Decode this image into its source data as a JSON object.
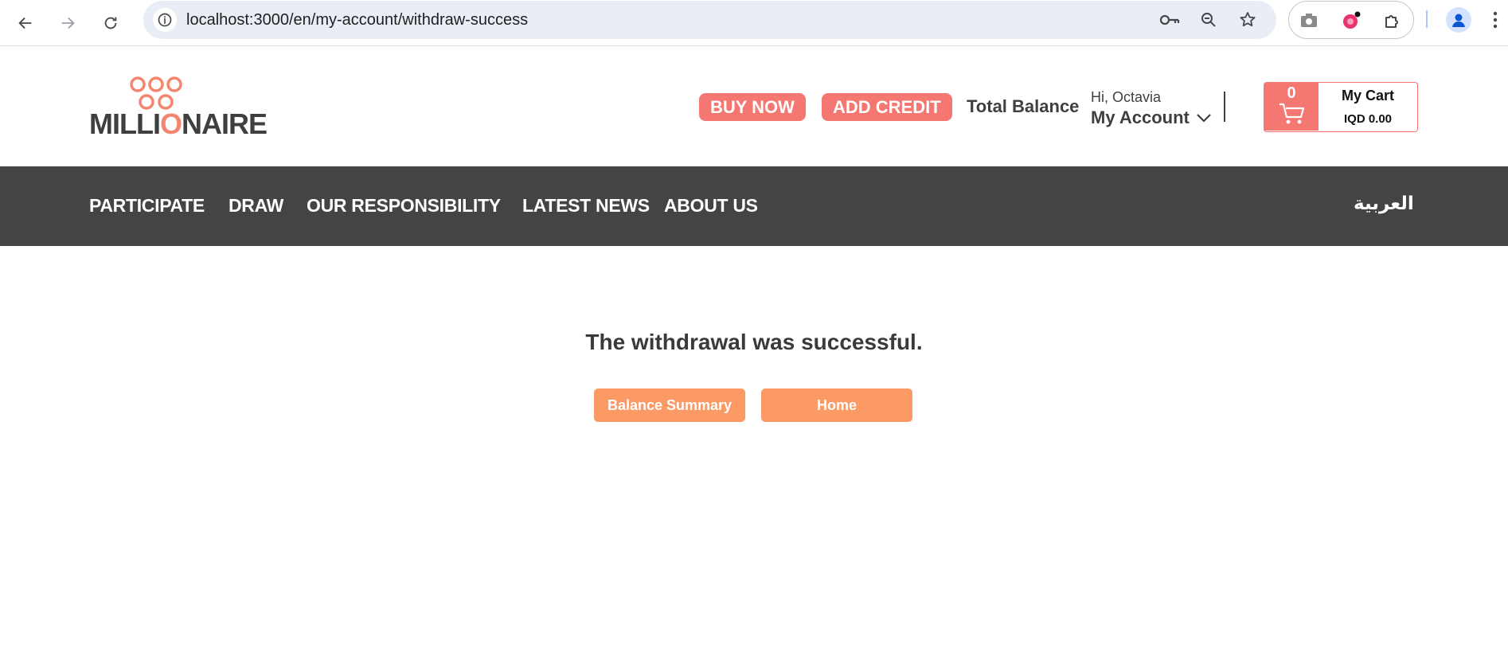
{
  "browser": {
    "url": "localhost:3000/en/my-account/withdraw-success",
    "icons": [
      "back-icon",
      "forward-icon",
      "reload-icon",
      "site-info-icon",
      "password-key-icon",
      "zoom-icon",
      "bookmark-star-icon",
      "camera-icon",
      "extension-record-icon",
      "extensions-puzzle-icon",
      "profile-icon",
      "menu-kebab-icon"
    ]
  },
  "header": {
    "logo_text_pre": "MILLI",
    "logo_text_o": "O",
    "logo_text_post": "NAIRE",
    "buy_now_label": "BUY NOW",
    "add_credit_label": "ADD CREDIT",
    "total_balance_label": "Total Balance",
    "greeting": "Hi, Octavia",
    "my_account_label": "My Account",
    "cart": {
      "count": "0",
      "title": "My Cart",
      "total": "IQD 0.00"
    }
  },
  "nav": {
    "items": [
      {
        "label": "PARTICIPATE"
      },
      {
        "label": "DRAW"
      },
      {
        "label": "OUR RESPONSIBILITY"
      },
      {
        "label": "LATEST NEWS"
      },
      {
        "label": "ABOUT US"
      }
    ],
    "language_label": "العربية"
  },
  "main": {
    "message": "The withdrawal was successful.",
    "balance_summary_label": "Balance Summary",
    "home_label": "Home"
  },
  "colors": {
    "accent_red": "#f47771",
    "accent_orange": "#fb9a65",
    "nav_bg": "#444444",
    "logo_orange": "#f48670"
  }
}
